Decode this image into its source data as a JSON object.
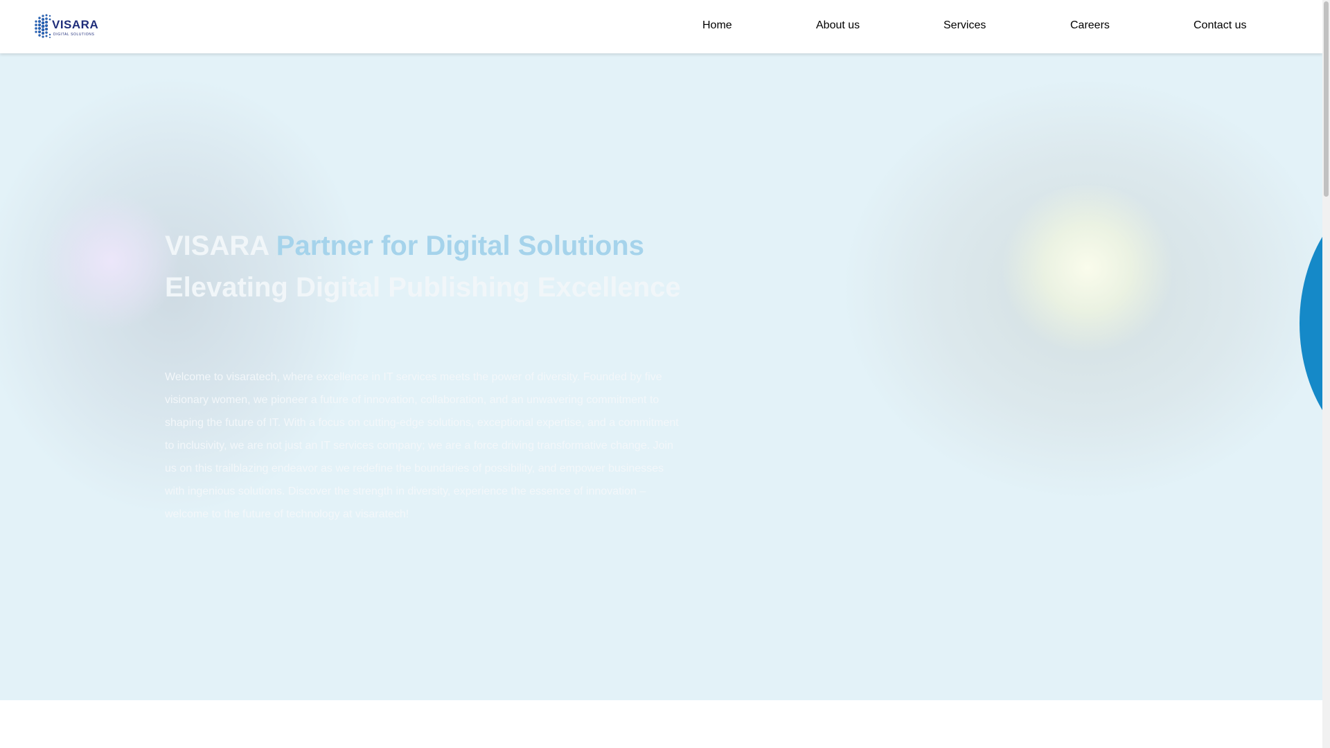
{
  "header": {
    "logo": {
      "name": "VISARA",
      "tagline": "DIGITAL SOLUTIONS",
      "color": "#1f2d7a"
    },
    "nav": [
      {
        "label": "Home"
      },
      {
        "label": "About us"
      },
      {
        "label": "Services"
      },
      {
        "label": "Careers"
      },
      {
        "label": "Contact us"
      }
    ]
  },
  "hero": {
    "title_brand": "VISARA",
    "title_rest": "Partner for Digital Solutions",
    "title_line2": "Elevating Digital Publishing Excellence",
    "body": "Welcome to visaratech, where excellence in IT services meets the power of diversity. Founded by five visionary women, we pioneer a future of innovation, collaboration, and an unwavering commitment to shaping the future of IT. With a focus on cutting-edge solutions, exceptional expertise, and a commitment to inclusivity, we are not just an IT services company; we are a force driving transformative change. Join us on this trailblazing endeavor as we redefine the boundaries of possibility, and empower businesses with ingenious solutions. Discover the strength in diversity, experience the essence of innovation – welcome to the future of technology at visaratech!",
    "colors": {
      "background": "#e3f2f8",
      "title_accent": "#a5d3eb",
      "arc": "#1589c8"
    }
  }
}
